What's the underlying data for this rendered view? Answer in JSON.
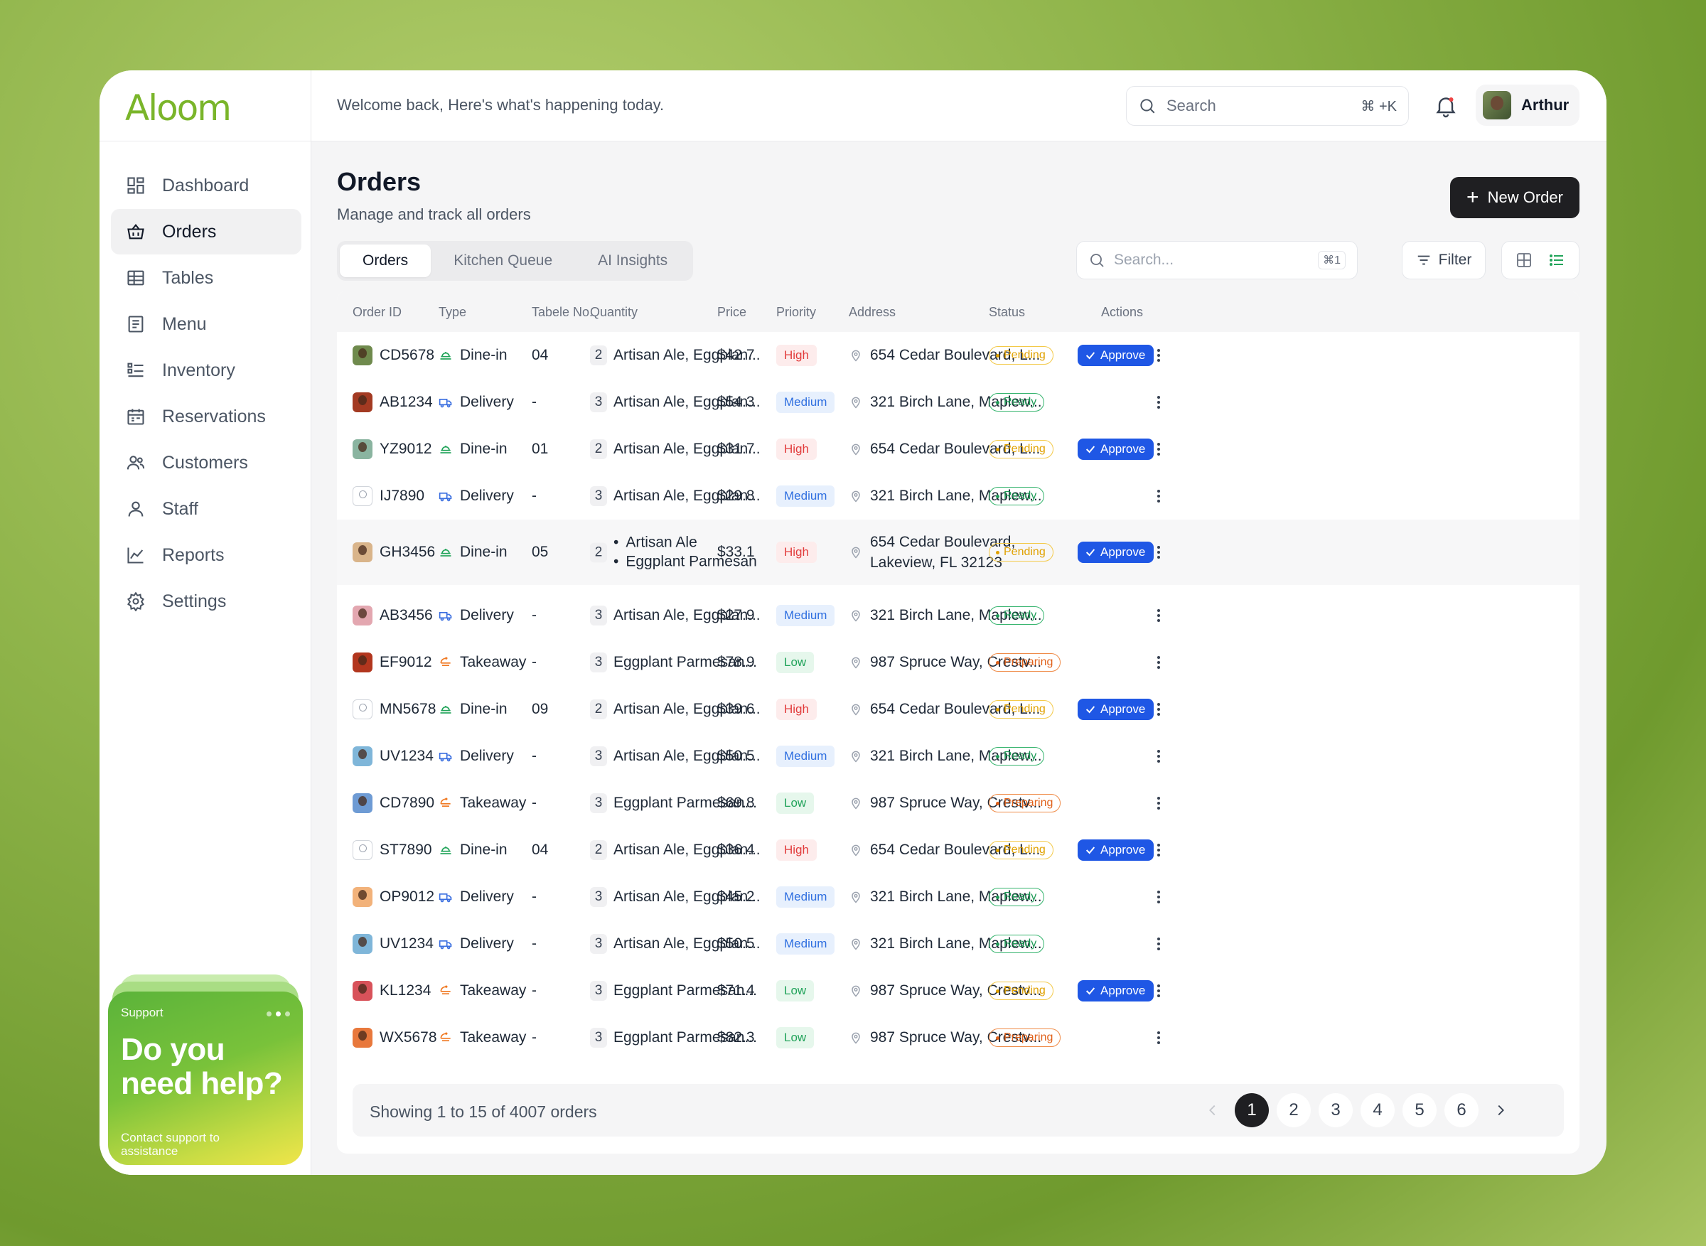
{
  "brand": {
    "logo_text": "Aloom",
    "accent": "#7ab52a"
  },
  "sidebar": {
    "items": [
      {
        "label": "Dashboard",
        "icon": "dashboard-icon",
        "active": false
      },
      {
        "label": "Orders",
        "icon": "basket-icon",
        "active": true
      },
      {
        "label": "Tables",
        "icon": "table-grid-icon",
        "active": false
      },
      {
        "label": "Menu",
        "icon": "menu-doc-icon",
        "active": false
      },
      {
        "label": "Inventory",
        "icon": "list-icon",
        "active": false
      },
      {
        "label": "Reservations",
        "icon": "calendar-icon",
        "active": false
      },
      {
        "label": "Customers",
        "icon": "users-icon",
        "active": false
      },
      {
        "label": "Staff",
        "icon": "user-icon",
        "active": false
      },
      {
        "label": "Reports",
        "icon": "chart-icon",
        "active": false
      },
      {
        "label": "Settings",
        "icon": "gear-icon",
        "active": false
      }
    ],
    "support": {
      "label": "Support",
      "title": "Do you need help?",
      "subtitle": "Contact support to assistance"
    }
  },
  "topbar": {
    "welcome": "Welcome back, Here's what's happening today.",
    "search_placeholder": "Search",
    "search_shortcut": "⌘ +K",
    "user_name": "Arthur"
  },
  "page": {
    "title": "Orders",
    "subtitle": "Manage and track all orders",
    "new_order_label": "New Order",
    "tabs": [
      {
        "label": "Orders",
        "active": true
      },
      {
        "label": "Kitchen Queue",
        "active": false
      },
      {
        "label": "AI Insights",
        "active": false
      }
    ],
    "search_placeholder": "Search...",
    "search_shortcut": "⌘1",
    "filter_label": "Filter"
  },
  "table": {
    "columns": [
      "Order ID",
      "Type",
      "Tabele No.",
      "Quantity",
      "Price",
      "Priority",
      "Address",
      "Status",
      "Actions"
    ],
    "rows": [
      {
        "id": "CD5678",
        "avatar": "#6f8a4d",
        "type": "Dine-in",
        "table": "04",
        "qty": "2",
        "items": "Artisan Ale, Eggplan...",
        "price": "$42.7",
        "priority": "High",
        "address": "654 Cedar Boulevard, L...",
        "status": "Pending",
        "approve": "Approve"
      },
      {
        "id": "AB1234",
        "avatar": "#a33a22",
        "type": "Delivery",
        "table": "-",
        "qty": "3",
        "items": "Artisan Ale, Eggplan...",
        "price": "$54.3",
        "priority": "Medium",
        "address": "321 Birch Lane, Maplew...",
        "status": "Ready",
        "approve": ""
      },
      {
        "id": "YZ9012",
        "avatar": "#8ab4a0",
        "type": "Dine-in",
        "table": "01",
        "qty": "2",
        "items": "Artisan Ale, Eggplan...",
        "price": "$31.7",
        "priority": "High",
        "address": "654 Cedar Boulevard, L...",
        "status": "Pending",
        "approve": "Approve"
      },
      {
        "id": "IJ7890",
        "avatar": "",
        "type": "Delivery",
        "table": "-",
        "qty": "3",
        "items": "Artisan Ale, Eggplan...",
        "price": "$29.8",
        "priority": "Medium",
        "address": "321 Birch Lane, Maplew...",
        "status": "Ready",
        "approve": ""
      },
      {
        "id": "GH3456",
        "avatar": "#d9b48a",
        "type": "Dine-in",
        "table": "05",
        "qty": "2",
        "items": "",
        "items_list": [
          "Artisan Ale",
          "Eggplant Parmesan"
        ],
        "price": "$33.1",
        "priority": "High",
        "address": "",
        "address_lines": [
          "654 Cedar Boulevard,",
          "Lakeview, FL 32123"
        ],
        "status": "Pending",
        "approve": "Approve"
      },
      {
        "id": "AB3456",
        "avatar": "#e3a7b0",
        "type": "Delivery",
        "table": "-",
        "qty": "3",
        "items": "Artisan Ale, Eggplan...",
        "price": "$27.9",
        "priority": "Medium",
        "address": "321 Birch Lane, Maplew...",
        "status": "Ready",
        "approve": ""
      },
      {
        "id": "EF9012",
        "avatar": "#b2361e",
        "type": "Takeaway",
        "table": "-",
        "qty": "3",
        "items": "Eggplant Parmesan...",
        "price": "$78.9",
        "priority": "Low",
        "address": "987 Spruce Way, Crestv...",
        "status": "Preparing",
        "approve": ""
      },
      {
        "id": "MN5678",
        "avatar": "",
        "type": "Dine-in",
        "table": "09",
        "qty": "2",
        "items": "Artisan Ale, Eggplan...",
        "price": "$39.6",
        "priority": "High",
        "address": "654 Cedar Boulevard, L...",
        "status": "Pending",
        "approve": "Approve"
      },
      {
        "id": "UV1234",
        "avatar": "#7fb6d9",
        "type": "Delivery",
        "table": "-",
        "qty": "3",
        "items": "Artisan Ale, Eggplan...",
        "price": "$50.5",
        "priority": "Medium",
        "address": "321 Birch Lane, Maplew...",
        "status": "Ready",
        "approve": ""
      },
      {
        "id": "CD7890",
        "avatar": "#6e9bd4",
        "type": "Takeaway",
        "table": "-",
        "qty": "3",
        "items": "Eggplant Parmesan...",
        "price": "$69.8",
        "priority": "Low",
        "address": "987 Spruce Way, Crestv...",
        "status": "Preparing",
        "approve": ""
      },
      {
        "id": "ST7890",
        "avatar": "",
        "type": "Dine-in",
        "table": "04",
        "qty": "2",
        "items": "Artisan Ale, Eggplan...",
        "price": "$36.4",
        "priority": "High",
        "address": "654 Cedar Boulevard, L...",
        "status": "Pending",
        "approve": "Approve"
      },
      {
        "id": "OP9012",
        "avatar": "#f2b27a",
        "type": "Delivery",
        "table": "-",
        "qty": "3",
        "items": "Artisan Ale, Eggplan...",
        "price": "$45.2",
        "priority": "Medium",
        "address": "321 Birch Lane, Maplew...",
        "status": "Ready",
        "approve": ""
      },
      {
        "id": "UV1234",
        "avatar": "#7fb6d9",
        "type": "Delivery",
        "table": "-",
        "qty": "3",
        "items": "Artisan Ale, Eggplan...",
        "price": "$50.5",
        "priority": "Medium",
        "address": "321 Birch Lane, Maplew...",
        "status": "Ready",
        "approve": ""
      },
      {
        "id": "KL1234",
        "avatar": "#d8525a",
        "type": "Takeaway",
        "table": "-",
        "qty": "3",
        "items": "Eggplant Parmesan...",
        "price": "$71.4",
        "priority": "Low",
        "address": "987 Spruce Way, Crestv...",
        "status": "Pending",
        "approve": "Approve"
      },
      {
        "id": "WX5678",
        "avatar": "#e8783c",
        "type": "Takeaway",
        "table": "-",
        "qty": "3",
        "items": "Eggplant Parmesan...",
        "price": "$82.3",
        "priority": "Low",
        "address": "987 Spruce Way, Crestv...",
        "status": "Preparing",
        "approve": ""
      }
    ]
  },
  "pagination": {
    "info": "Showing 1 to 15 of 4007 orders",
    "pages": [
      "1",
      "2",
      "3",
      "4",
      "5",
      "6"
    ],
    "current": "1"
  }
}
